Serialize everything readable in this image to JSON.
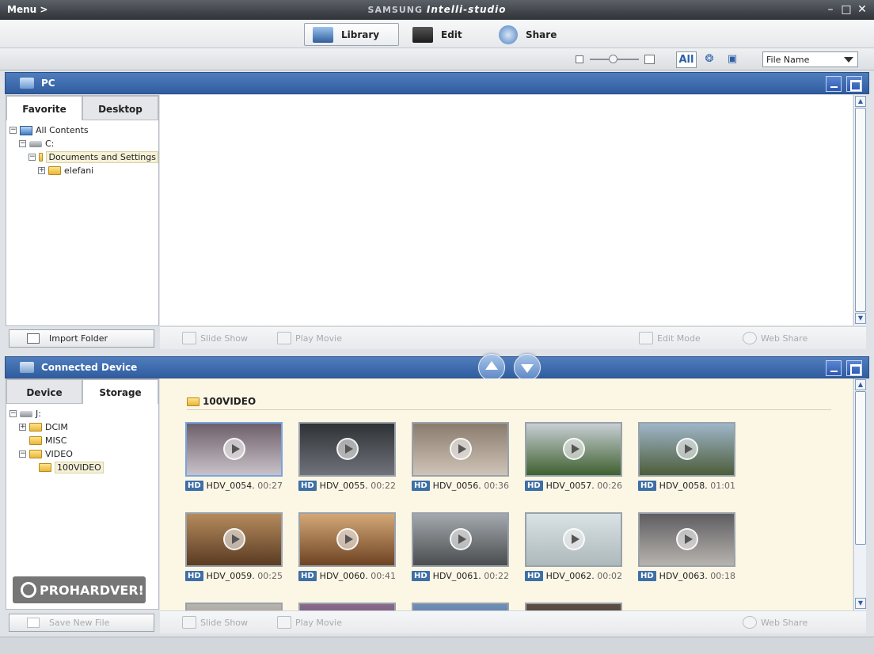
{
  "app": {
    "menu_label": "Menu >",
    "brand": "SAMSUNG",
    "product": "Intelli-studio"
  },
  "modes": [
    {
      "label": "Library",
      "active": true
    },
    {
      "label": "Edit",
      "active": false
    },
    {
      "label": "Share",
      "active": false
    }
  ],
  "toolbar": {
    "view_all_label": "All",
    "sort_value": "File Name"
  },
  "pc_panel": {
    "title": "PC",
    "tabs": [
      "Favorite",
      "Desktop"
    ],
    "active_tab": "Favorite",
    "tree": [
      {
        "label": "All Contents",
        "level": 0,
        "expander": "-",
        "icon": "all-contents-icon"
      },
      {
        "label": "C:",
        "level": 1,
        "expander": "-",
        "icon": "drive-icon"
      },
      {
        "label": "Documents and Settings",
        "level": 2,
        "expander": "-",
        "icon": "folder-icon",
        "selected": true
      },
      {
        "label": "elefani",
        "level": 3,
        "expander": "+",
        "icon": "folder-icon"
      }
    ],
    "import_label": "Import Folder",
    "actions": {
      "slide_show": "Slide Show",
      "play_movie": "Play Movie",
      "edit_mode": "Edit Mode",
      "web_share": "Web Share"
    }
  },
  "device_panel": {
    "title": "Connected Device",
    "tabs": [
      "Device",
      "Storage"
    ],
    "active_tab": "Storage",
    "tree": [
      {
        "label": "J:",
        "level": 0,
        "expander": "-",
        "icon": "drive-icon"
      },
      {
        "label": "DCIM",
        "level": 1,
        "expander": "+",
        "icon": "folder-icon"
      },
      {
        "label": "MISC",
        "level": 1,
        "expander": "",
        "icon": "folder-icon"
      },
      {
        "label": "VIDEO",
        "level": 1,
        "expander": "-",
        "icon": "folder-icon"
      },
      {
        "label": "100VIDEO",
        "level": 2,
        "expander": "",
        "icon": "folder-icon",
        "selected": true
      }
    ],
    "folder_title": "100VIDEO",
    "hd_badge": "HD",
    "videos": [
      {
        "name": "HDV_0054.",
        "duration": "00:27",
        "colors": [
          "#6d5f6a",
          "#c9c2c9"
        ],
        "selected": true
      },
      {
        "name": "HDV_0055.",
        "duration": "00:22",
        "colors": [
          "#2e3135",
          "#6f737a"
        ]
      },
      {
        "name": "HDV_0056.",
        "duration": "00:36",
        "colors": [
          "#8a7c6d",
          "#cfc4b8"
        ]
      },
      {
        "name": "HDV_0057.",
        "duration": "00:26",
        "colors": [
          "#c8cfd4",
          "#3f6130"
        ]
      },
      {
        "name": "HDV_0058.",
        "duration": "01:01",
        "colors": [
          "#9fb6c9",
          "#4c5d3a"
        ]
      },
      {
        "name": "HDV_0059.",
        "duration": "00:25",
        "colors": [
          "#b58b5d",
          "#5a3b22"
        ]
      },
      {
        "name": "HDV_0060.",
        "duration": "00:41",
        "colors": [
          "#d3a877",
          "#6e4323"
        ]
      },
      {
        "name": "HDV_0061.",
        "duration": "00:22",
        "colors": [
          "#a3a9ae",
          "#4b4d4f"
        ]
      },
      {
        "name": "HDV_0062.",
        "duration": "00:02",
        "colors": [
          "#d9e2e4",
          "#aeb9bb"
        ]
      },
      {
        "name": "HDV_0063.",
        "duration": "00:18",
        "colors": [
          "#5e5d61",
          "#b7b3ae"
        ]
      }
    ],
    "save_label": "Save New File",
    "actions": {
      "slide_show": "Slide Show",
      "play_movie": "Play Movie",
      "web_share": "Web Share"
    }
  },
  "watermark": "PROHARDVER!"
}
